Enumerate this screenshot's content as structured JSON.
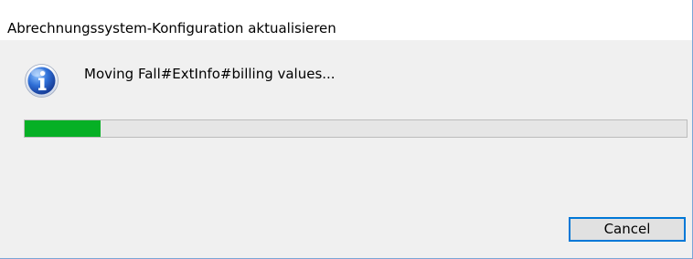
{
  "window": {
    "title": "Abrechnungssystem-Konfiguration aktualisieren"
  },
  "dialog": {
    "icon": "info-icon",
    "message": "Moving Fall#ExtInfo#billing values...",
    "progress": 0.115,
    "progress_color": "#06b025"
  },
  "buttons": {
    "cancel_label": "Cancel"
  },
  "colors": {
    "accent": "#0078d7",
    "window_border": "#7aa6d6"
  }
}
